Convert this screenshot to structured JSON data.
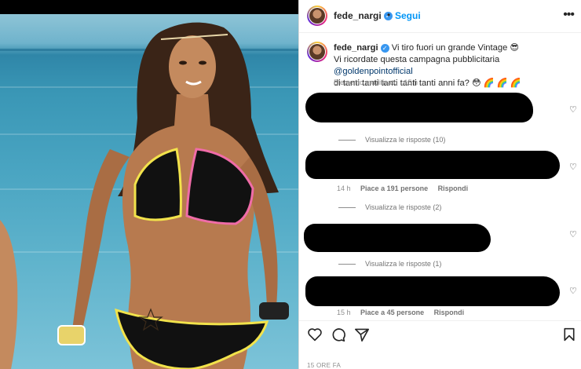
{
  "post": {
    "username": "fede_nargi",
    "follow_label": "Segui",
    "separator": "•",
    "more_label": "•••"
  },
  "caption": {
    "username": "fede_nargi",
    "text_1": "Vi tiro fuori un grande Vintage 😎",
    "text_2": "Vi ricordate questa campagna pubblicitaria ",
    "mention": "@goldenpointofficial",
    "text_3": "di tanti tanti tanti tanti tanti anni fa? 😳 🌈 🌈 🌈",
    "meta": "Elemento modificato · 15 h"
  },
  "comments": [
    {
      "replies_label": "Visualizza le risposte (10)"
    },
    {
      "time": "14 h",
      "likes": "Piace a 191 persone",
      "reply": "Rispondi",
      "replies_label": "Visualizza le risposte (2)"
    },
    {
      "replies_label": "Visualizza le risposte (1)"
    },
    {
      "time": "15 h",
      "likes": "Piace a 45 persone",
      "reply": "Rispondi"
    }
  ],
  "footer": {
    "timestamp": "15 ORE FA"
  },
  "icons": {
    "heart": "heart-icon",
    "comment": "comment-icon",
    "share": "share-icon",
    "save": "bookmark-icon",
    "more": "more-options-icon",
    "verified": "verified-badge-icon"
  },
  "colors": {
    "link_blue": "#0095f6",
    "mention": "#00376b",
    "verified": "#3897f0",
    "muted": "#8e8e8e"
  }
}
